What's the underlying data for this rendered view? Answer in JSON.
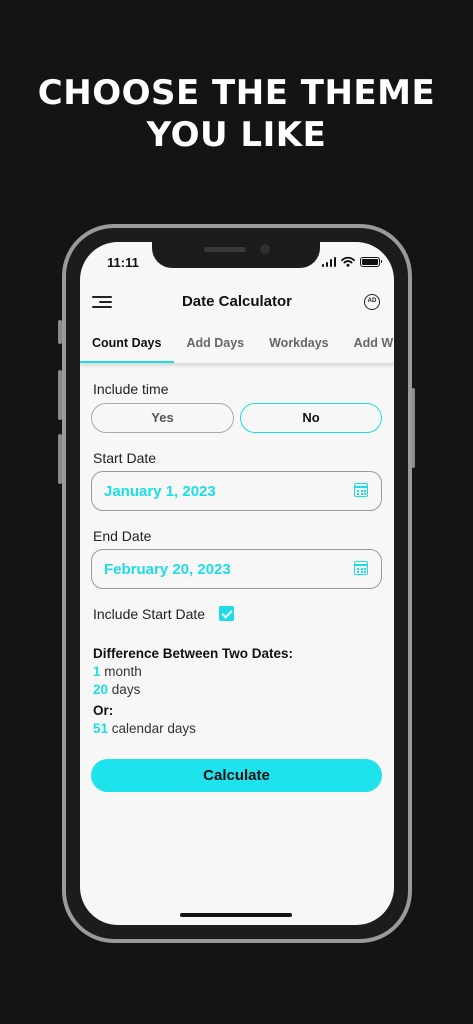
{
  "headline": {
    "line1": "CHOOSE THE THEME",
    "line2": "YOU LIKE"
  },
  "status_bar": {
    "time": "11:11"
  },
  "app_bar": {
    "title": "Date Calculator",
    "ad_badge": "AD"
  },
  "tabs": [
    {
      "label": "Count Days",
      "active": true
    },
    {
      "label": "Add Days",
      "active": false
    },
    {
      "label": "Workdays",
      "active": false
    },
    {
      "label": "Add W",
      "active": false
    }
  ],
  "include_time": {
    "label": "Include time",
    "options": [
      "Yes",
      "No"
    ],
    "selected": "No"
  },
  "start_date": {
    "label": "Start Date",
    "value": "January 1, 2023"
  },
  "end_date": {
    "label": "End Date",
    "value": "February 20, 2023"
  },
  "include_start_date": {
    "label": "Include Start Date",
    "checked": true
  },
  "result": {
    "title": "Difference Between Two Dates:",
    "months_value": "1",
    "months_unit": "month",
    "days_value": "20",
    "days_unit": "days",
    "or_label": "Or:",
    "calendar_days_value": "51",
    "calendar_days_unit": "calendar days"
  },
  "calculate_button": {
    "label": "Calculate"
  },
  "colors": {
    "accent": "#1cdde6",
    "background": "#141414",
    "screen": "#f7f7f7"
  }
}
